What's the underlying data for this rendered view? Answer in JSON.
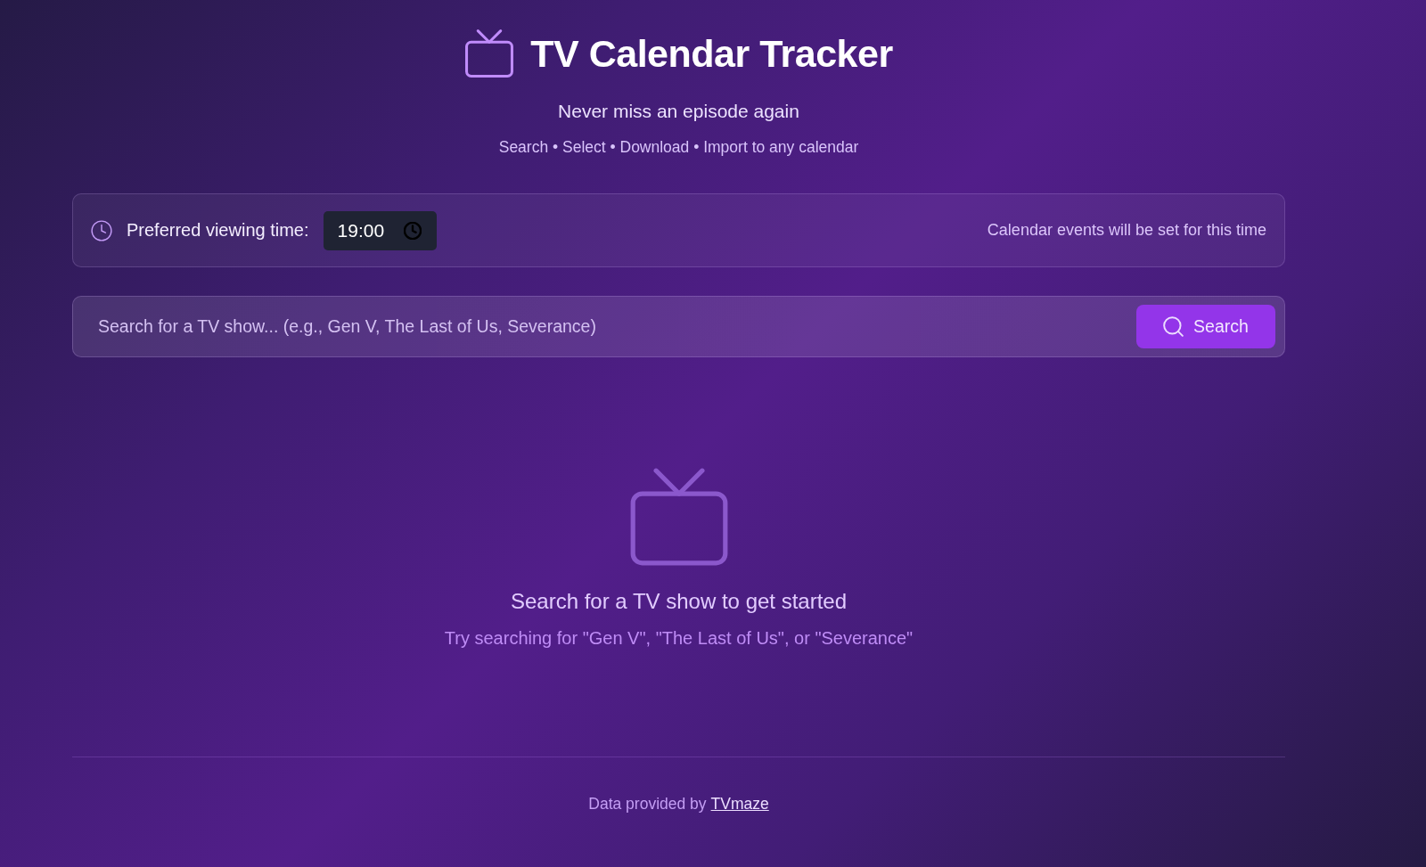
{
  "header": {
    "title": "TV Calendar Tracker",
    "tagline": "Never miss an episode again",
    "steps": "Search • Select • Download • Import to any calendar"
  },
  "time_preference": {
    "label": "Preferred viewing time:",
    "value": "19:00",
    "note": "Calendar events will be set for this time"
  },
  "search": {
    "placeholder": "Search for a TV show... (e.g., Gen V, The Last of Us, Severance)",
    "button": "Search"
  },
  "empty_state": {
    "heading": "Search for a TV show to get started",
    "hint": "Try searching for \"Gen V\", \"The Last of Us\", or \"Severance\""
  },
  "footer": {
    "text": "Data provided by",
    "link": "TVmaze"
  }
}
